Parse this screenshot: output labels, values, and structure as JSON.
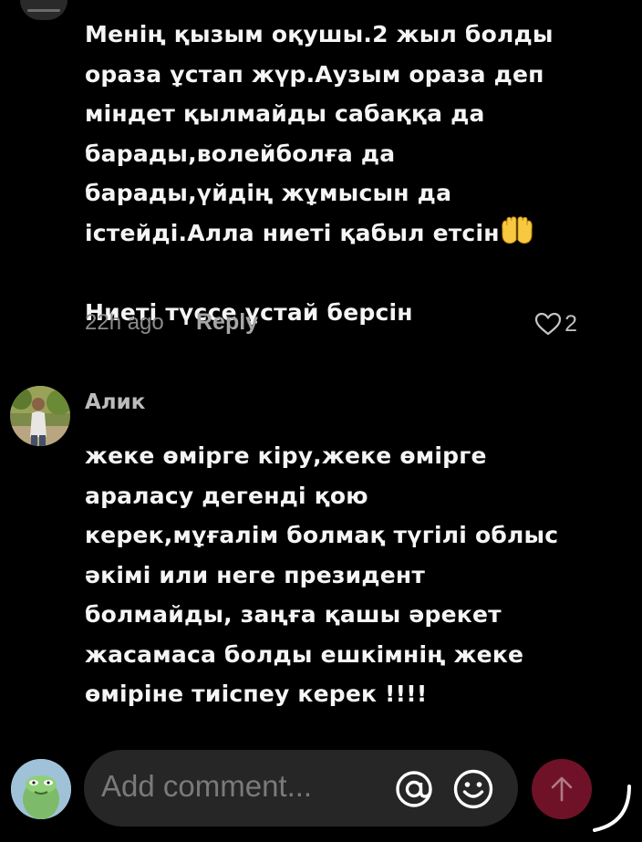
{
  "comment1": {
    "text_lines": "Менің қызым оқушы.2 жыл болды\nораза ұстап жүр.Аузым ораза деп\nміндет қылмайды сабаққа да\nбарады,волейболға да\nбарады,үйдің жұмысын да\nістейді.Алла ниеті қабыл етсін",
    "text_after_emoji": "Ниеті түссе ұстай берсін",
    "emoji": "palms-up-together",
    "time": "22h ago",
    "reply_label": "Reply",
    "like_count": "2"
  },
  "comment2": {
    "author": "Алик",
    "text": "жеке өмірге кіру,жеке өмірге\nараласу дегенді қою\nкерек,мұғалім болмақ түгілі облыс\nәкімі или неге президент\nболмайды, заңға қашы әрекет\nжасамаса болды ешкімнің жеке\nөміріне тиіспеу керек !!!!"
  },
  "composer": {
    "placeholder": "Add comment...",
    "mention_icon": "at-icon",
    "emoji_icon": "smile-icon",
    "send_icon": "arrow-up-icon",
    "send_color": "#6f1228"
  }
}
